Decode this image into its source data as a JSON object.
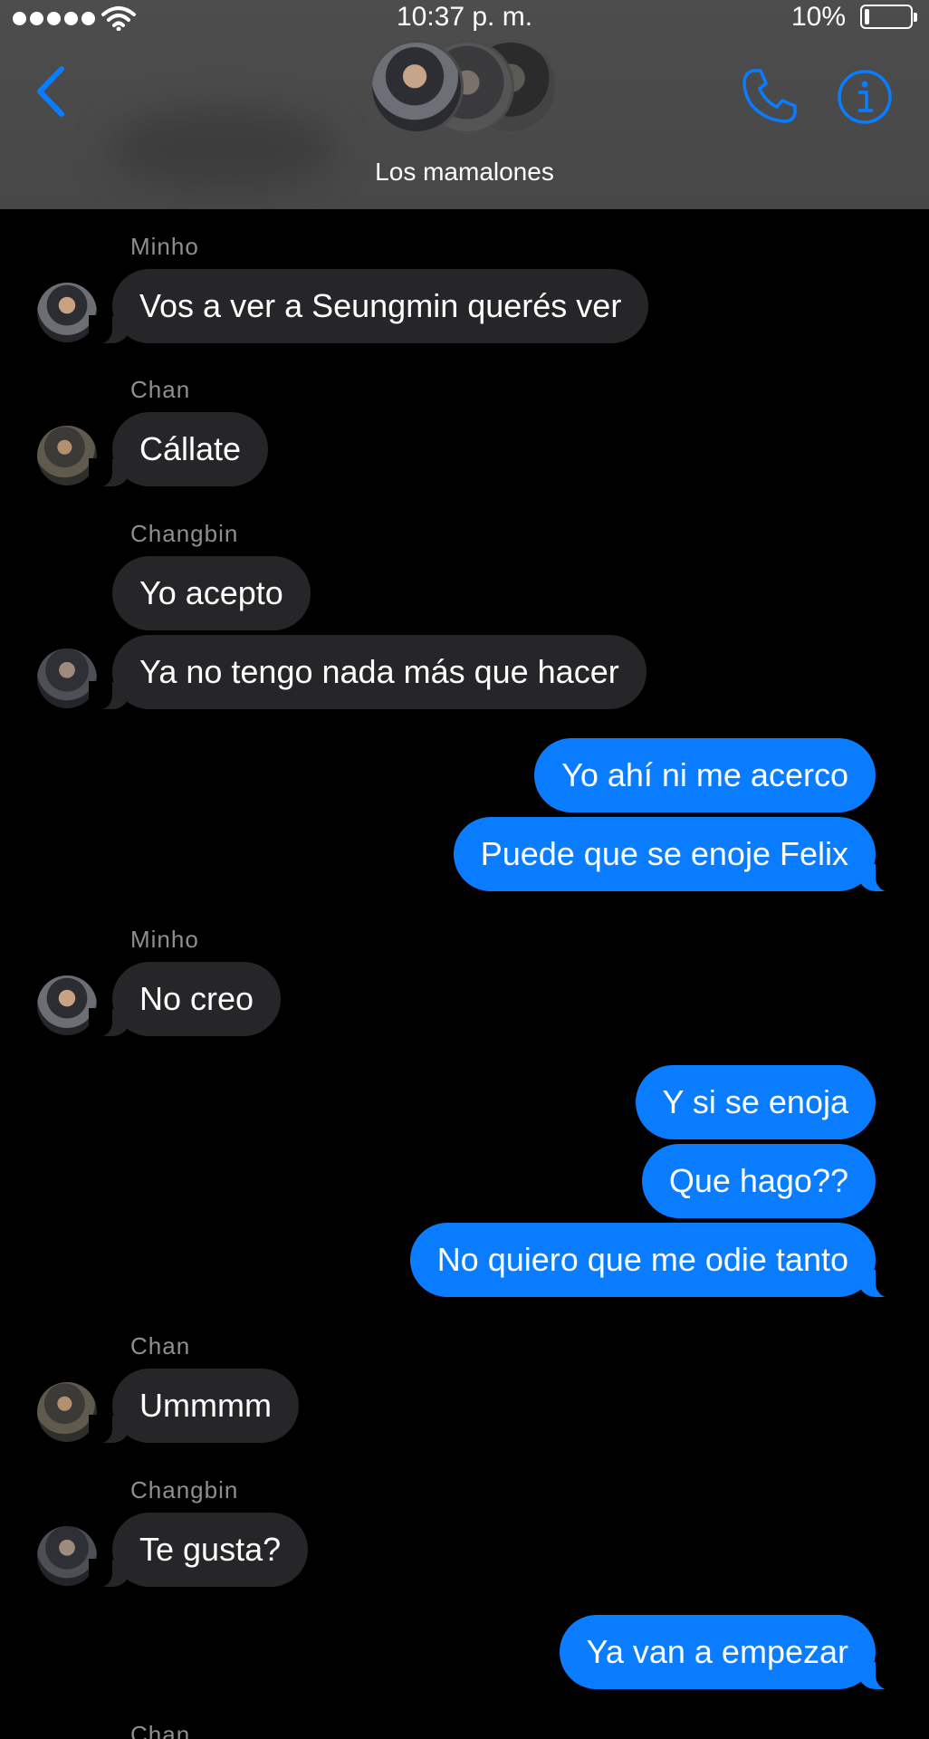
{
  "status_bar": {
    "time": "10:37 p. m.",
    "battery": "10%",
    "signal_bars": 5,
    "battery_level": 0.1
  },
  "header": {
    "group_name": "Los mamalones",
    "back_icon": "chevron-left-icon",
    "call_icon": "phone-icon",
    "info_icon": "info-icon",
    "accent_color": "#0a7cff"
  },
  "messages": [
    {
      "sender": "Minho"
    },
    {
      "text": "Vos a ver a Seungmin querés ver"
    },
    {
      "sender": "Chan"
    },
    {
      "text": "Cállate"
    },
    {
      "sender": "Changbin"
    },
    {
      "text": "Yo acepto"
    },
    {
      "text": "Ya no tengo nada más que hacer"
    },
    {
      "text": "Yo ahí ni me acerco"
    },
    {
      "text": "Puede que se enoje Felix"
    },
    {
      "sender": "Minho"
    },
    {
      "text": "No creo"
    },
    {
      "text": "Y si se enoja"
    },
    {
      "text": "Que hago??"
    },
    {
      "text": "No quiero que me odie tanto"
    },
    {
      "sender": "Chan"
    },
    {
      "text": "Ummmm"
    },
    {
      "sender": "Changbin"
    },
    {
      "text": "Te gusta?"
    },
    {
      "text": "Ya van a empezar"
    },
    {
      "sender": "Chan"
    }
  ],
  "colors": {
    "incoming_bubble": "#262628",
    "outgoing_bubble": "#0a7cff",
    "background": "#000000",
    "header": "#4a4a4a"
  }
}
